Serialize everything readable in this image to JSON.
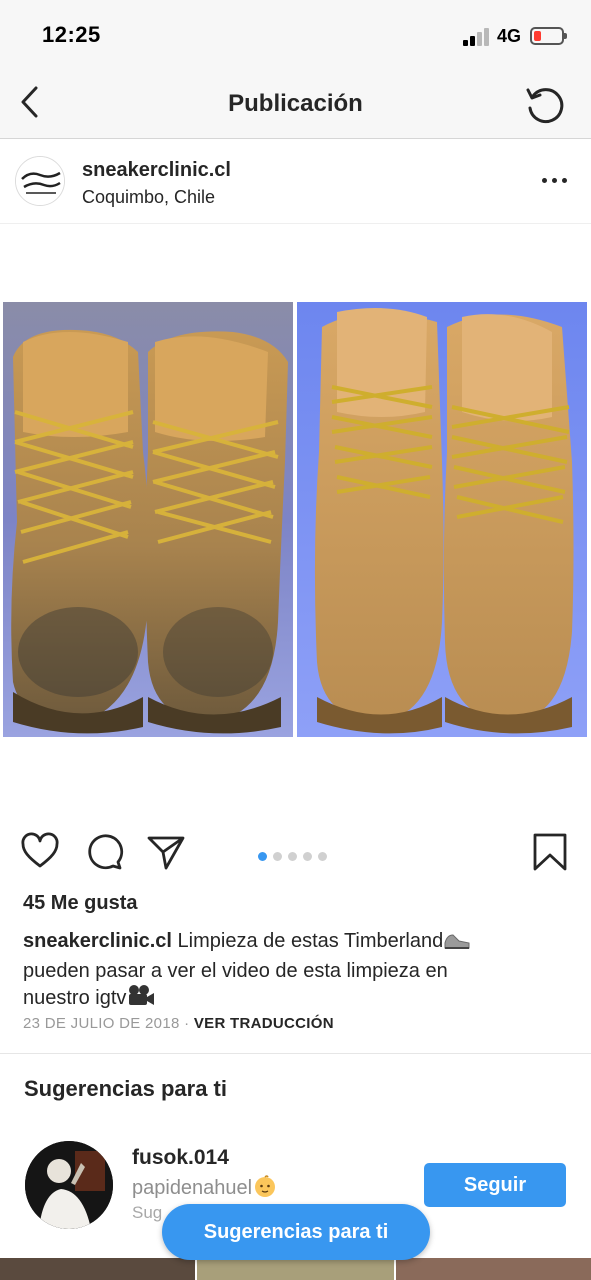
{
  "status_bar": {
    "time": "12:25",
    "network": "4G",
    "battery_level_fraction": 0.2
  },
  "header": {
    "title": "Publicación",
    "back_icon": "chevron-left-icon",
    "refresh_icon": "refresh-icon"
  },
  "post": {
    "username": "sneakerclinic.cl",
    "location": "Coquimbo, Chile",
    "avatar_text": "Sneaker Clinic",
    "likes": "45 Me gusta",
    "caption_user": "sneakerclinic.cl",
    "caption_line1": " Limpieza de estas Timberland",
    "caption_line2": "pueden pasar a ver el video de esta limpieza en",
    "caption_line3": "nuestro igtv",
    "date": "23 DE JULIO DE 2018",
    "separator": " · ",
    "translate": "VER TRADUCCIÓN",
    "carousel": {
      "count": 5,
      "active": 0
    }
  },
  "suggestions": {
    "title": "Sugerencias para ti",
    "items": [
      {
        "username": "fusok.014",
        "subtitle": "papidenahuel",
        "meta": "Sug",
        "button": "Seguir"
      }
    ],
    "toast": "Sugerencias para ti"
  },
  "colors": {
    "accent": "#3897f0",
    "text": "#262626",
    "muted": "#8e8e8e",
    "header_bg": "#f7f7f7"
  }
}
